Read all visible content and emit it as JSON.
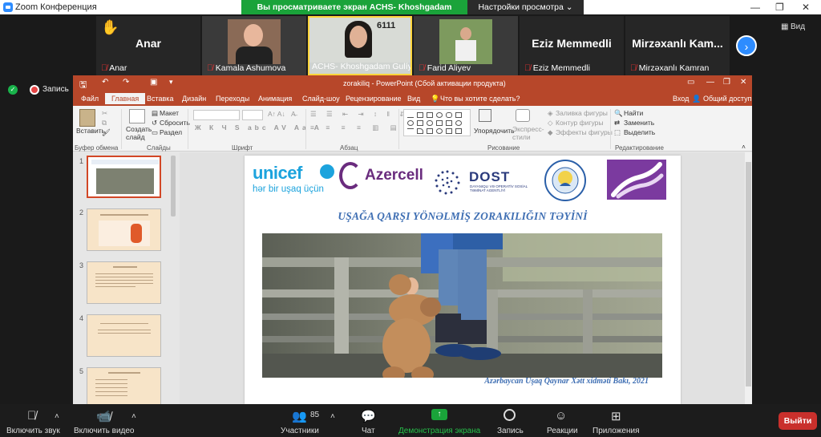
{
  "zoom": {
    "window_title": "Zoom Конференция",
    "share_banner": "Вы просматриваете экран ACHS- Khoshgadam Guliyeva",
    "view_settings": "Настройки просмотра ⌄",
    "view_label": "Вид",
    "record_label": "Запись",
    "participants": [
      {
        "big_name": "Anar",
        "caption": "Anar"
      },
      {
        "big_name": "",
        "caption": "Kamala Ashumova"
      },
      {
        "big_name": "",
        "caption": "ACHS- Khoshgadam Gulíy..."
      },
      {
        "big_name": "",
        "caption": "Farid Aliyev"
      },
      {
        "big_name": "Eziz Memmedli",
        "caption": "Eziz Memmedli"
      },
      {
        "big_name": "Mirzəxanlı Kam...",
        "caption": "Mirzəxanlı Kamran"
      }
    ],
    "bottom": {
      "audio": "Включить звук",
      "video": "Включить видео",
      "participants": "Участники",
      "participants_count": "85",
      "chat": "Чат",
      "share": "Демонстрация экрана",
      "record": "Запись",
      "reactions": "Реакции",
      "apps": "Приложения",
      "leave": "Выйти"
    }
  },
  "ppt": {
    "title": "zorakiliq - PowerPoint (Сбой активации продукта)",
    "tabs": [
      "Файл",
      "Главная",
      "Вставка",
      "Дизайн",
      "Переходы",
      "Анимация",
      "Слайд-шоу",
      "Рецензирование",
      "Вид"
    ],
    "search_hint": "Что вы хотите сделать?",
    "signin": "Вход",
    "share": "Общий доступ",
    "ribbon": {
      "paste": "Вставить",
      "clipboard": "Буфер обмена",
      "new_slide": "Создать слайд",
      "layout": "Макет",
      "reset": "Сбросить",
      "section": "Раздел",
      "slides": "Слайды",
      "font": "Шрифт",
      "paragraph": "Абзац",
      "arrange": "Упорядочить",
      "quick_styles": "Экспресс-стили",
      "drawing": "Рисование",
      "shape_fill": "Заливка фигуры",
      "shape_outline": "Контур фигуры",
      "shape_effects": "Эффекты фигуры",
      "find": "Найти",
      "replace": "Заменить",
      "select": "Выделить",
      "editing": "Редактирование"
    },
    "thumb_numbers": [
      "1",
      "2",
      "3",
      "4",
      "5"
    ],
    "slide": {
      "unicef": "unicef",
      "unicef_sub": "hər bir uşaq üçün",
      "azercell": "Azercell",
      "dost": "DOST",
      "dost_sub": "DAYANIQLI VƏ OPERATİV SOSİAL TƏMİNAT AGENTLİYİ",
      "heading": "UŞAĞA QARŞI YÖNƏLMİŞ ZORAKILIĞIN TƏYİNİ",
      "footer": "Azərbaycan Uşaq Qaynar Xətt xidməti Bakı, 2021"
    }
  }
}
